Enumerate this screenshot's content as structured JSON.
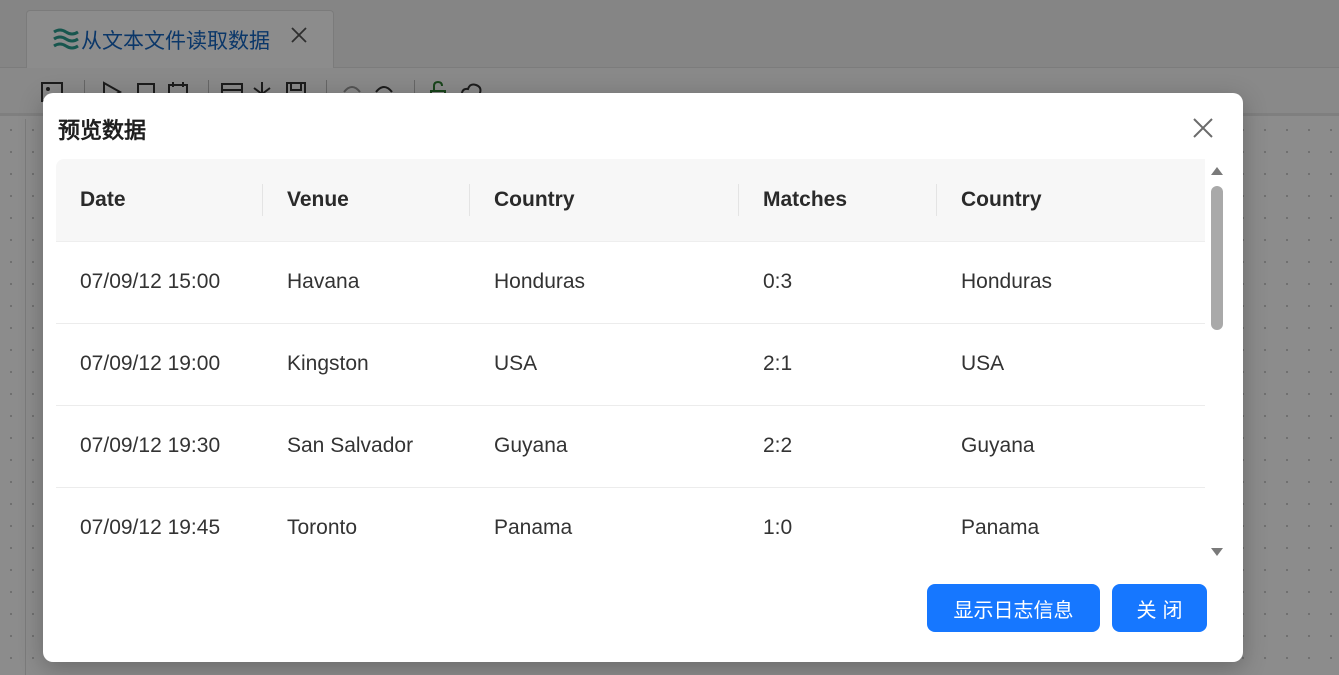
{
  "tab": {
    "title": "从文本文件读取数据",
    "icon": "wave-lines-icon",
    "close_icon": "close-icon"
  },
  "colors": {
    "primary": "#1677ff",
    "tab_title": "#1565c0",
    "header_bg": "#f7f7f7"
  },
  "modal": {
    "title": "预览数据",
    "close_icon": "close-icon",
    "table": {
      "columns": [
        "Date",
        "Venue",
        "Country",
        "Matches",
        "Country"
      ],
      "rows": [
        [
          "07/09/12 15:00",
          "Havana",
          "Honduras",
          "0:3",
          "Honduras"
        ],
        [
          "07/09/12 19:00",
          "Kingston",
          "USA",
          "2:1",
          "USA"
        ],
        [
          "07/09/12 19:30",
          "San Salvador",
          "Guyana",
          "2:2",
          "Guyana"
        ],
        [
          "07/09/12 19:45",
          "Toronto",
          "Panama",
          "1:0",
          "Panama"
        ]
      ]
    },
    "buttons": {
      "show_log": "显示日志信息",
      "close": "关闭"
    }
  }
}
